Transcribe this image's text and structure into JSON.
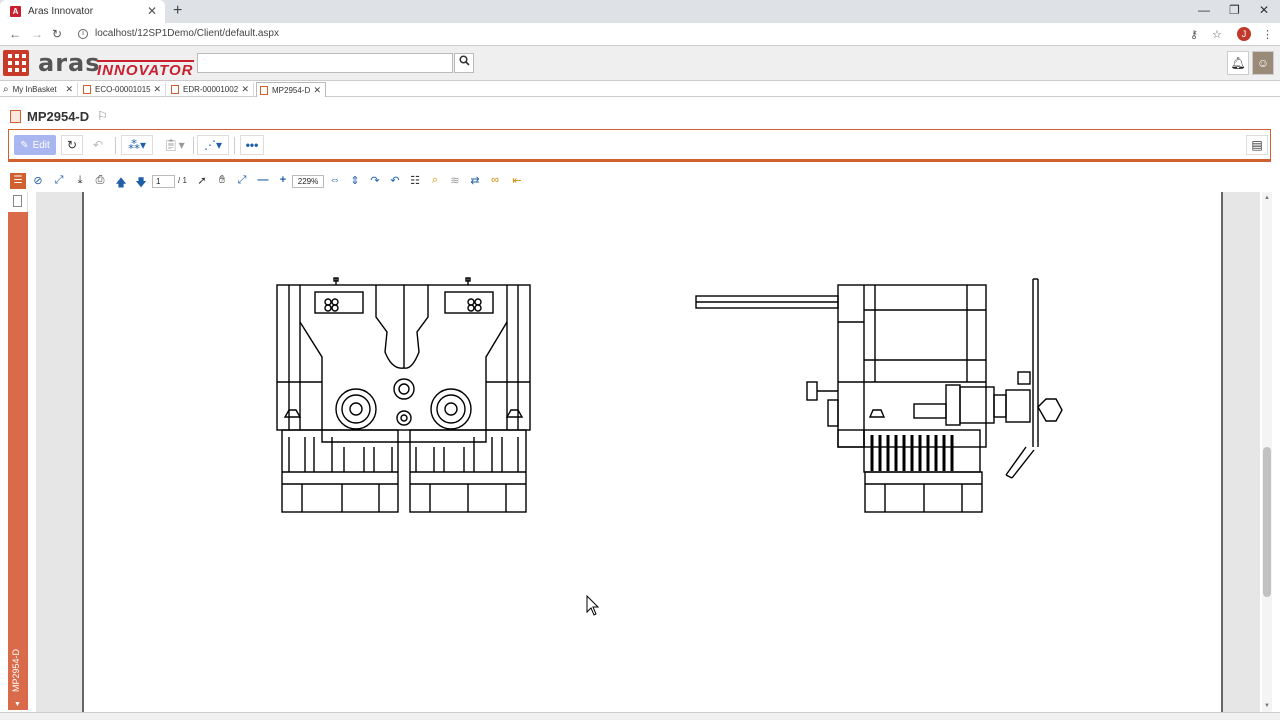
{
  "browser": {
    "tab_title": "Aras Innovator",
    "tab_favicon": "A",
    "url": "localhost/12SP1Demo/Client/default.aspx",
    "user_initial": "J"
  },
  "header": {
    "logo_main": "aras",
    "logo_sub": "INNOVATOR",
    "search_value": "",
    "brand_color": "#c8202f"
  },
  "item_tabs": [
    {
      "label": "My InBasket",
      "icon": "search-icon"
    },
    {
      "label": "ECO-00001015",
      "icon": "document-icon"
    },
    {
      "label": "EDR-00001002",
      "icon": "document-icon"
    },
    {
      "label": "MP2954-D",
      "icon": "document-icon",
      "active": true
    }
  ],
  "item": {
    "title": "MP2954-D",
    "side_label": "MP2954-D"
  },
  "commands": {
    "edit_label": "Edit"
  },
  "viewer": {
    "page_number": "1",
    "page_total": "/ 1",
    "zoom": "229%"
  }
}
